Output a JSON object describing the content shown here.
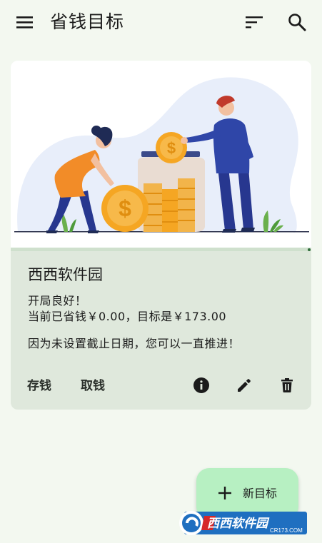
{
  "appbar": {
    "title": "省钱目标",
    "menu_icon": "menu-icon",
    "sort_icon": "sort-icon",
    "search_icon": "search-icon"
  },
  "goal_card": {
    "title": "西西软件园",
    "status_line1": "开局良好！",
    "status_line2": "当前已省钱￥0.00，目标是￥173.00",
    "deadline_text": "因为未设置截止日期，您可以一直推进！",
    "progress": 0.0,
    "actions": {
      "deposit_label": "存钱",
      "withdraw_label": "取钱",
      "info_icon": "info-icon",
      "edit_icon": "edit-icon",
      "delete_icon": "delete-icon"
    }
  },
  "fab": {
    "label": "新目标",
    "icon": "plus-icon"
  },
  "watermark": {
    "brand": "西西软件园",
    "url": "CR173.COM"
  },
  "colors": {
    "background": "#f3f8f0",
    "card": "#dfe8dc",
    "fab": "#b7f0c2",
    "coin": "#f5a623",
    "figure_blue": "#27378f"
  }
}
